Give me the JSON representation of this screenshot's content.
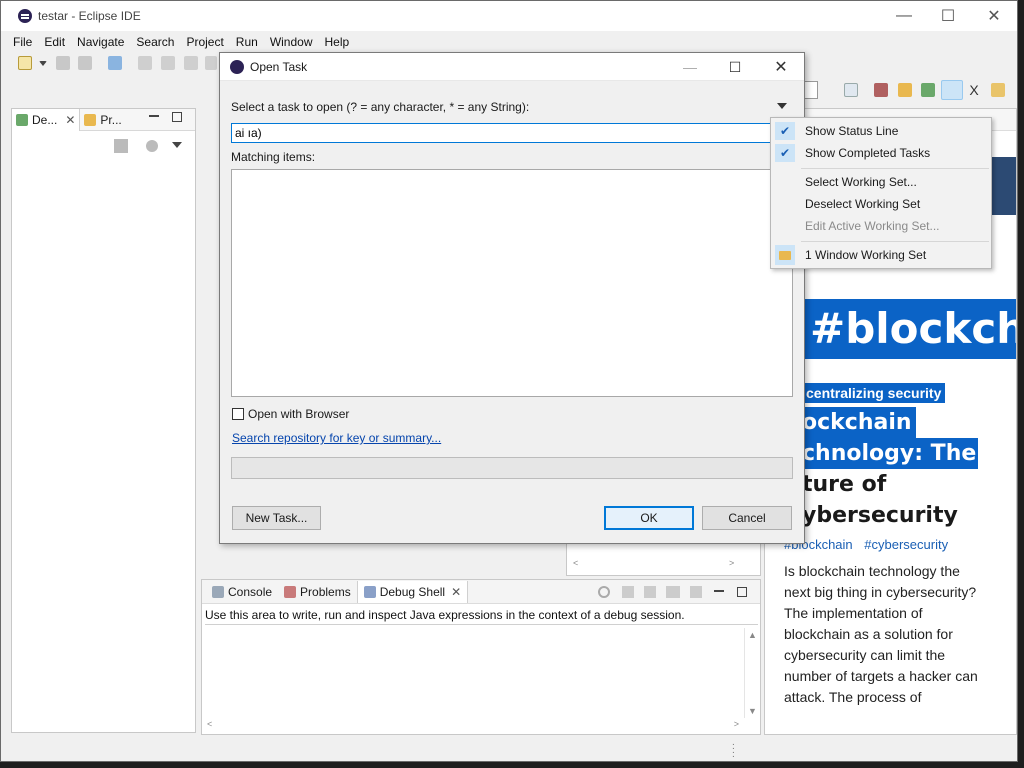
{
  "window": {
    "title": "testar - Eclipse IDE",
    "controls": [
      "—",
      "☐",
      "✕"
    ]
  },
  "menubar": [
    "File",
    "Edit",
    "Navigate",
    "Search",
    "Project",
    "Run",
    "Window",
    "Help"
  ],
  "left_panel": {
    "tabs": [
      {
        "label": "De..."
      },
      {
        "label": "Pr..."
      }
    ]
  },
  "console": {
    "tabs": [
      {
        "label": "Console"
      },
      {
        "label": "Problems"
      },
      {
        "label": "Debug Shell"
      }
    ],
    "hint": "Use this area to write, run and inspect Java expressions in the context of a debug session."
  },
  "blog": {
    "title": "#blockchai",
    "subtitle": "centralizing security",
    "headline": [
      "ockchain",
      "chnology: The",
      "ture of",
      "ybersecurity"
    ],
    "tags": [
      "#blockchain",
      "#cybersecurity"
    ],
    "body": "Is blockchain technology the next big thing in cybersecurity? The implementation of blockchain as a solution for cybersecurity can limit the number of targets a hacker can attack. The process of"
  },
  "dialog": {
    "title": "Open Task",
    "prompt": "Select a task to open (? = any character, * = any String):",
    "input_value": "ai ıa)",
    "matching_label": "Matching items:",
    "open_with_browser": "Open with Browser",
    "open_with_browser_checked": false,
    "search_link": "Search repository for key or summary...",
    "buttons": {
      "new_task": "New Task...",
      "ok": "OK",
      "cancel": "Cancel"
    }
  },
  "dropdown_menu": {
    "items": [
      {
        "label": "Show Status Line",
        "checked": true,
        "enabled": true
      },
      {
        "label": "Show Completed Tasks",
        "checked": true,
        "enabled": true
      },
      {
        "label": "Select Working Set...",
        "checked": false,
        "enabled": true
      },
      {
        "label": "Deselect Working Set",
        "checked": false,
        "enabled": true
      },
      {
        "label": "Edit Active Working Set...",
        "checked": false,
        "enabled": false
      },
      {
        "label": "1 Window Working Set",
        "checked": false,
        "enabled": true,
        "icon": "folder-icon"
      }
    ]
  },
  "colors": {
    "accent": "#0078d7",
    "highlight": "#0b63c6",
    "link": "#0645ad"
  }
}
